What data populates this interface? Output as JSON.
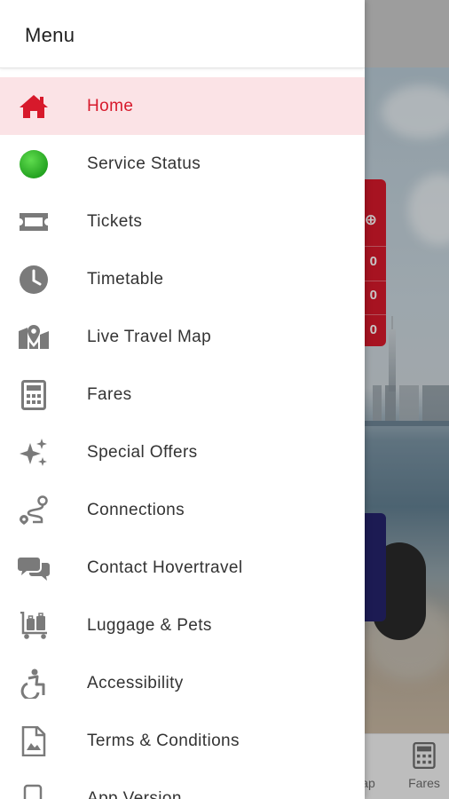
{
  "drawer": {
    "title": "Menu",
    "items": [
      {
        "label": "Home",
        "icon": "home-icon",
        "active": true
      },
      {
        "label": "Service Status",
        "icon": "status-dot-icon"
      },
      {
        "label": "Tickets",
        "icon": "ticket-icon"
      },
      {
        "label": "Timetable",
        "icon": "clock-icon"
      },
      {
        "label": "Live Travel Map",
        "icon": "map-pin-icon"
      },
      {
        "label": "Fares",
        "icon": "calculator-icon"
      },
      {
        "label": "Special Offers",
        "icon": "sparkles-icon"
      },
      {
        "label": "Connections",
        "icon": "route-icon"
      },
      {
        "label": "Contact Hovertravel",
        "icon": "chat-icon"
      },
      {
        "label": "Luggage & Pets",
        "icon": "luggage-trolley-icon"
      },
      {
        "label": "Accessibility",
        "icon": "accessibility-icon"
      },
      {
        "label": "Terms & Conditions",
        "icon": "document-icon"
      },
      {
        "label": "App Version",
        "icon": "phone-icon"
      }
    ]
  },
  "background": {
    "tabs": [
      {
        "label": "ap",
        "icon": "map-icon"
      },
      {
        "label": "Fares",
        "icon": "calculator-icon"
      }
    ],
    "card_glyphs": [
      "0",
      "0",
      "0"
    ]
  },
  "colors": {
    "accent_red": "#d7192b",
    "active_bg": "#fbe3e6",
    "status_green": "#2eb82e",
    "icon_grey": "#7a7a7a",
    "navy": "#25236b"
  }
}
